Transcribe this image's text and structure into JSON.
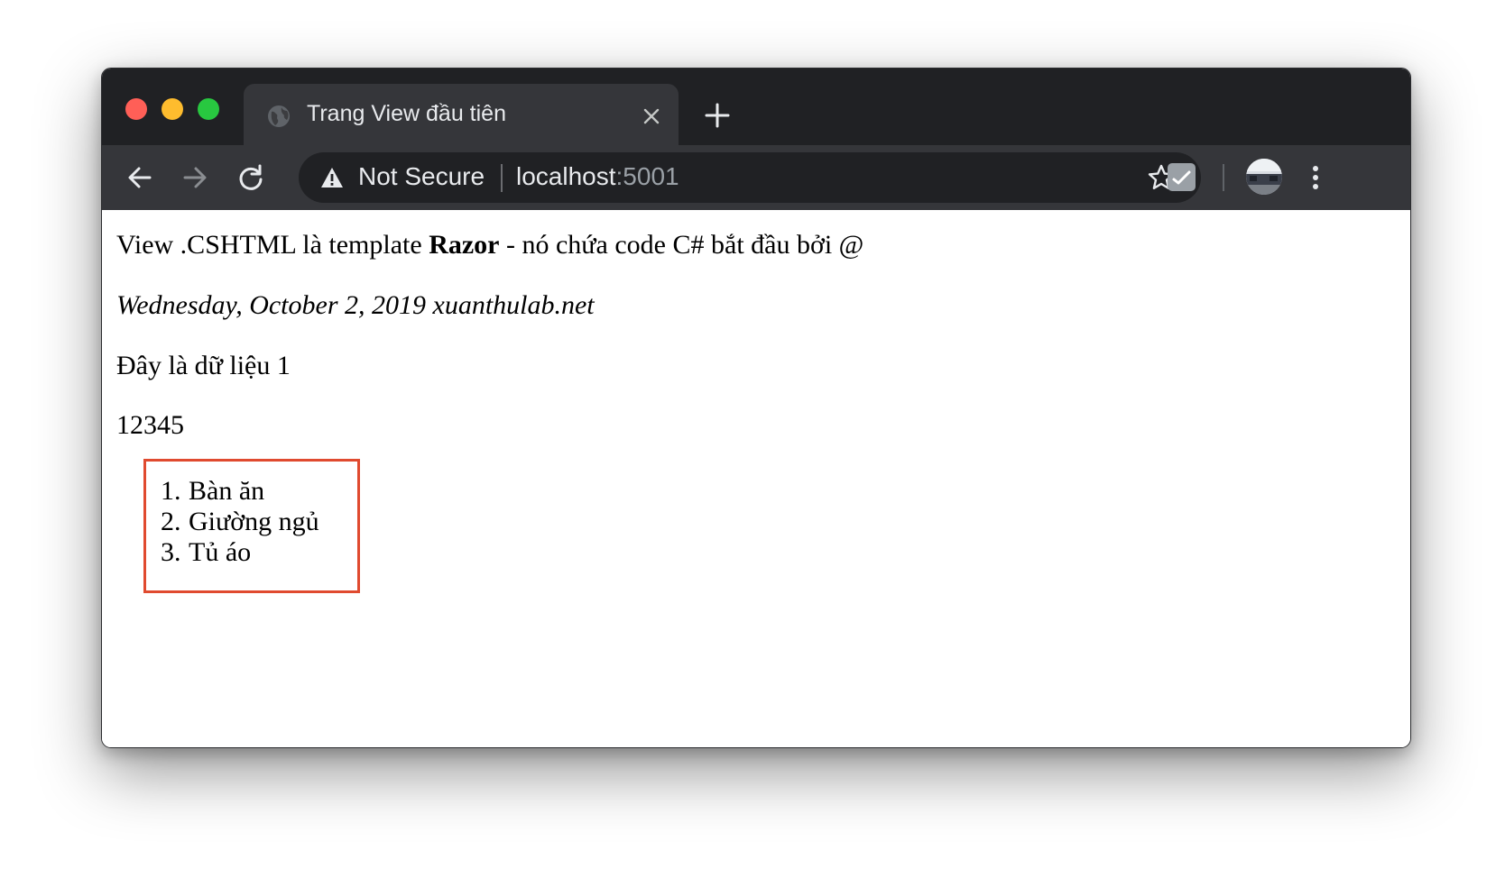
{
  "browser": {
    "tab": {
      "title": "Trang View đầu tiên",
      "favicon": "globe-icon"
    },
    "toolbar": {
      "security_label": "Not Secure",
      "url_host": "localhost",
      "url_port": ":5001",
      "icons": [
        "back-arrow-icon",
        "forward-arrow-icon",
        "reload-icon",
        "warning-icon",
        "star-icon",
        "extension-icon",
        "profile-avatar",
        "menu-dots-icon"
      ]
    },
    "colors": {
      "frame": "#202124",
      "toolbar": "#35363a",
      "highlight_box": "#e04a2f"
    }
  },
  "page": {
    "line1": {
      "before": "View .CSHTML là template ",
      "bold": "Razor",
      "after": " - nó chứa code C# bắt đầu bởi @"
    },
    "line2": "Wednesday, October 2, 2019 xuanthulab.net",
    "line3": "Đây là dữ liệu 1",
    "line4": "12345",
    "list": [
      {
        "number": "1.",
        "label": "Bàn ăn"
      },
      {
        "number": "2.",
        "label": "Giường ngủ"
      },
      {
        "number": "3.",
        "label": "Tủ áo"
      }
    ]
  }
}
